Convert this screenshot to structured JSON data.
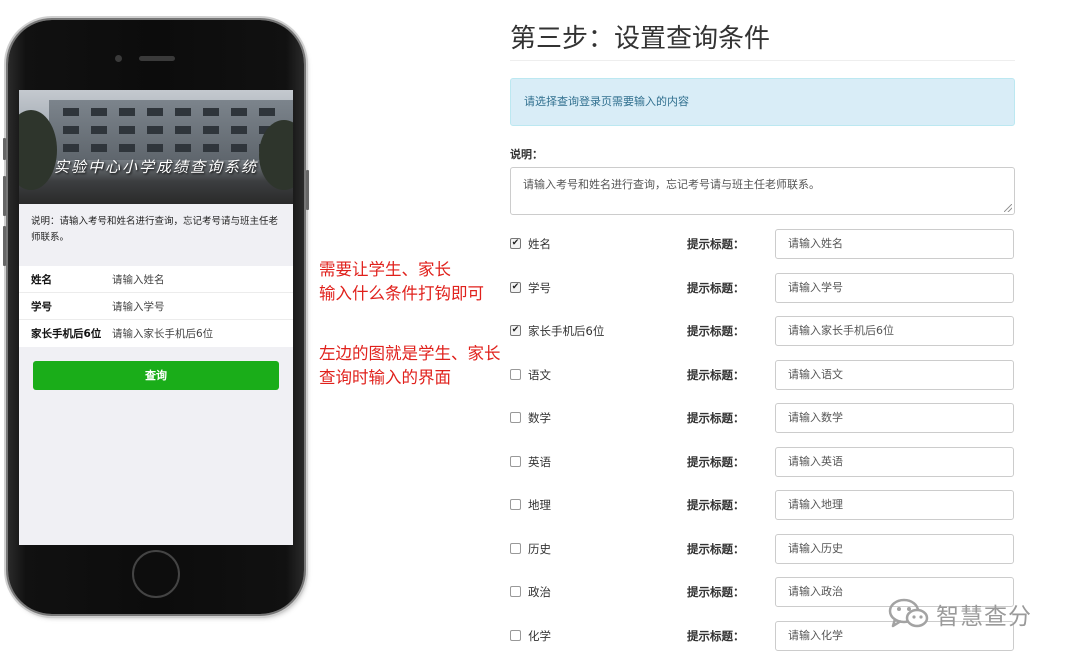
{
  "phone": {
    "banner_title": "实验中心小学成绩查询系统",
    "note": "说明：请输入考号和姓名进行查询，忘记考号请与班主任老师联系。",
    "fields": [
      {
        "label": "姓名",
        "placeholder": "请输入姓名"
      },
      {
        "label": "学号",
        "placeholder": "请输入学号"
      },
      {
        "label": "家长手机后6位",
        "placeholder": "请输入家长手机后6位"
      }
    ],
    "query_button": "查询"
  },
  "annotation": {
    "line1": "需要让学生、家长",
    "line2": "输入什么条件打钩即可",
    "line3": "左边的图就是学生、家长",
    "line4": "查询时输入的界面"
  },
  "form": {
    "title": "第三步：设置查询条件",
    "info": "请选择查询登录页需要输入的内容",
    "desc_label": "说明：",
    "desc_value": "请输入考号和姓名进行查询，忘记考号请与班主任老师联系。",
    "hint_label": "提示标题：",
    "fields": [
      {
        "name": "姓名",
        "checked": true,
        "hint": "请输入姓名"
      },
      {
        "name": "学号",
        "checked": true,
        "hint": "请输入学号"
      },
      {
        "name": "家长手机后6位",
        "checked": true,
        "hint": "请输入家长手机后6位"
      },
      {
        "name": "语文",
        "checked": false,
        "hint": "请输入语文"
      },
      {
        "name": "数学",
        "checked": false,
        "hint": "请输入数学"
      },
      {
        "name": "英语",
        "checked": false,
        "hint": "请输入英语"
      },
      {
        "name": "地理",
        "checked": false,
        "hint": "请输入地理"
      },
      {
        "name": "历史",
        "checked": false,
        "hint": "请输入历史"
      },
      {
        "name": "政治",
        "checked": false,
        "hint": "请输入政治"
      },
      {
        "name": "化学",
        "checked": false,
        "hint": "请输入化学"
      }
    ]
  },
  "watermark": {
    "text": "智慧查分",
    "icon": "wechat-icon"
  }
}
